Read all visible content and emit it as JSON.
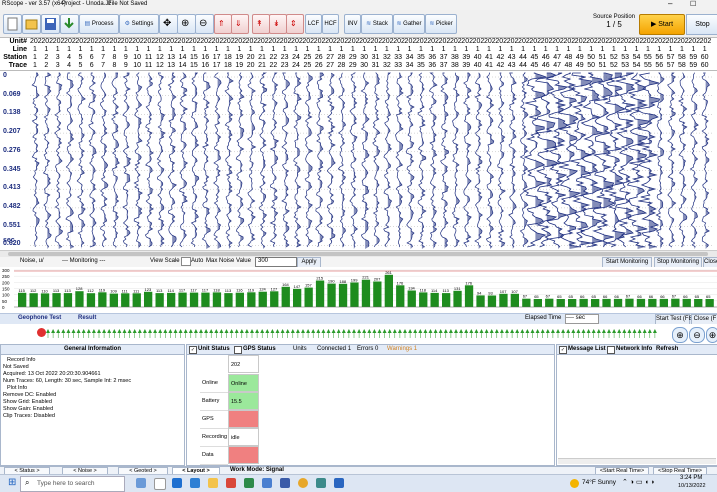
{
  "window": {
    "title": "RScope - ver 3.57 (x64)",
    "project": "Project - Unoda.Jz",
    "file_status": "File Not Saved"
  },
  "toolbar": {
    "process_label": "Process",
    "settings_label": "Settings",
    "lcf_label": "LCF",
    "hcf_label": "HCF",
    "inv_label": "INV",
    "stack_label": "Stack",
    "gather_label": "Gather",
    "picker_label": "Picker",
    "source_position_label": "Source Position",
    "source_position_value": "1 / 5",
    "start_label": "Start",
    "stop_label": "Stop",
    "elapsed_label": "Elapsed Tim",
    "elapsed_value": "sec"
  },
  "headers": {
    "unit_label": "Unit#",
    "line_label": "Line",
    "station_label": "Station",
    "trace_label": "Trace",
    "unit_values": [
      "202",
      "202",
      "202",
      "202",
      "202",
      "202",
      "202",
      "202",
      "202",
      "202",
      "202",
      "202",
      "202",
      "202",
      "202",
      "202",
      "202",
      "202",
      "202",
      "202",
      "202",
      "202",
      "202",
      "202",
      "202",
      "202",
      "202",
      "202",
      "202",
      "202",
      "202",
      "202",
      "202",
      "202",
      "202",
      "202",
      "202",
      "202",
      "202",
      "202",
      "202",
      "202",
      "202",
      "202",
      "202",
      "202",
      "202",
      "202",
      "202",
      "202",
      "202",
      "202",
      "202",
      "202",
      "202",
      "202",
      "202",
      "202",
      "202",
      "202"
    ],
    "line_values": [
      "1",
      "1",
      "1",
      "1",
      "1",
      "1",
      "1",
      "1",
      "1",
      "1",
      "1",
      "1",
      "1",
      "1",
      "1",
      "1",
      "1",
      "1",
      "1",
      "1",
      "1",
      "1",
      "1",
      "1",
      "1",
      "1",
      "1",
      "1",
      "1",
      "1",
      "1",
      "1",
      "1",
      "1",
      "1",
      "1",
      "1",
      "1",
      "1",
      "1",
      "1",
      "1",
      "1",
      "1",
      "1",
      "1",
      "1",
      "1",
      "1",
      "1",
      "1",
      "1",
      "1",
      "1",
      "1",
      "1",
      "1",
      "1",
      "1",
      "1"
    ],
    "station_values": [
      "1",
      "2",
      "3",
      "4",
      "5",
      "6",
      "7",
      "8",
      "9",
      "10",
      "11",
      "12",
      "13",
      "14",
      "15",
      "16",
      "17",
      "18",
      "19",
      "20",
      "21",
      "22",
      "23",
      "24",
      "25",
      "26",
      "27",
      "28",
      "29",
      "30",
      "31",
      "32",
      "33",
      "34",
      "35",
      "36",
      "37",
      "38",
      "39",
      "40",
      "41",
      "42",
      "43",
      "44",
      "45",
      "46",
      "47",
      "48",
      "49",
      "50",
      "51",
      "52",
      "53",
      "54",
      "55",
      "56",
      "57",
      "58",
      "59",
      "60"
    ],
    "trace_values": [
      "1",
      "2",
      "3",
      "4",
      "5",
      "6",
      "7",
      "8",
      "9",
      "10",
      "11",
      "12",
      "13",
      "14",
      "15",
      "16",
      "17",
      "18",
      "19",
      "20",
      "21",
      "22",
      "23",
      "24",
      "25",
      "26",
      "27",
      "28",
      "29",
      "30",
      "31",
      "32",
      "33",
      "34",
      "35",
      "36",
      "37",
      "38",
      "39",
      "40",
      "41",
      "42",
      "43",
      "44",
      "45",
      "46",
      "47",
      "48",
      "49",
      "50",
      "51",
      "52",
      "53",
      "54",
      "55",
      "56",
      "57",
      "58",
      "59",
      "60"
    ]
  },
  "seismic": {
    "time_labels": [
      "0",
      "0.069",
      "0.138",
      "0.207",
      "0.276",
      "0.345",
      "0.413",
      "0.482",
      "0.551",
      "0.620"
    ],
    "unit_label": "sec"
  },
  "monitor": {
    "noise_label": "Noise, u/",
    "monitoring_label": "--- Monitoring ---",
    "view_scale_label": "View Scale",
    "auto_label": "Auto",
    "max_noise_label": "Max Noise Value",
    "max_noise_value": "300",
    "apply_label": "Apply",
    "start_monitoring_label": "Start Monitoring",
    "stop_monitoring_label": "Stop Monitoring",
    "close_label": "Close"
  },
  "chart_data": {
    "type": "bar",
    "title": "",
    "xlabel": "",
    "ylabel": "",
    "ylim": [
      0,
      300
    ],
    "y_ticks": [
      "300",
      "250",
      "200",
      "150",
      "100",
      "50",
      "0"
    ],
    "values": [
      115,
      112,
      110,
      113,
      113,
      128,
      112,
      119,
      109,
      111,
      111,
      123,
      113,
      114,
      117,
      117,
      117,
      118,
      113,
      116,
      119,
      124,
      127,
      164,
      147,
      157,
      215,
      190,
      188,
      199,
      221,
      207,
      261,
      176,
      134,
      118,
      114,
      113,
      131,
      176,
      94,
      93,
      107,
      107,
      67,
      65,
      67,
      65,
      65,
      66,
      65,
      66,
      66,
      67,
      66,
      66,
      66,
      67,
      66,
      65,
      65
    ]
  },
  "geophone": {
    "test_label": "Geophone Test",
    "result_label": "Result",
    "elapsed_time_label": "Elapsed Time",
    "elapsed_time_value": "---- sec",
    "start_test_label": "Start Test (F8)",
    "close_label": "Close (F"
  },
  "general_info": {
    "title": "General Information",
    "lines": [
      "Record Info",
      "Not Saved",
      "Acquired: 13 Oct 2022 20:20:30.904661",
      "Num Traces: 60, Length: 30 sec, Sample Int: 2 msec",
      "Plot Info",
      "Remove DC: Enabled",
      "Show Grid: Enabled",
      "Show Gain: Enabled",
      "Clip Traces: Disabled"
    ]
  },
  "unit_status": {
    "unit_status_label": "Unit Status",
    "gps_status_label": "GPS Status",
    "units_label": "Units",
    "connected_label": "Connected 1",
    "errors_label": "Errors 0",
    "warnings_label": "Warnings 1",
    "unit_number": "202",
    "rows": [
      {
        "label": "Online",
        "value": "Online",
        "color": "#9be89b"
      },
      {
        "label": "Battery",
        "value": "15.5",
        "color": "#9be89b"
      },
      {
        "label": "GPS",
        "value": "",
        "color": "#f08080"
      },
      {
        "label": "Recording",
        "value": "idle",
        "color": "#ffffff"
      },
      {
        "label": "Data",
        "value": "",
        "color": "#f08080"
      }
    ]
  },
  "messages": {
    "message_list_label": "Message List",
    "network_info_label": "Network Info",
    "refresh_label": "Refresh"
  },
  "bottom_tabs": {
    "status": "< Status >",
    "noise": "< Noise >",
    "geoted": "< Geoted >",
    "layout": "< Layout >",
    "work_mode": "Work Mode: Signal",
    "start_real_time": "<Start Real Time>",
    "stop_real_time": "<Stop Real Time>"
  },
  "taskbar": {
    "search_placeholder": "Type here to search",
    "weather": "74°F Sunny",
    "time": "3:24 PM",
    "date": "10/13/2022"
  },
  "colors": {
    "accent": "#1f2f80",
    "bar_color": "#1e8c1e",
    "start_button": "#f4a300"
  }
}
